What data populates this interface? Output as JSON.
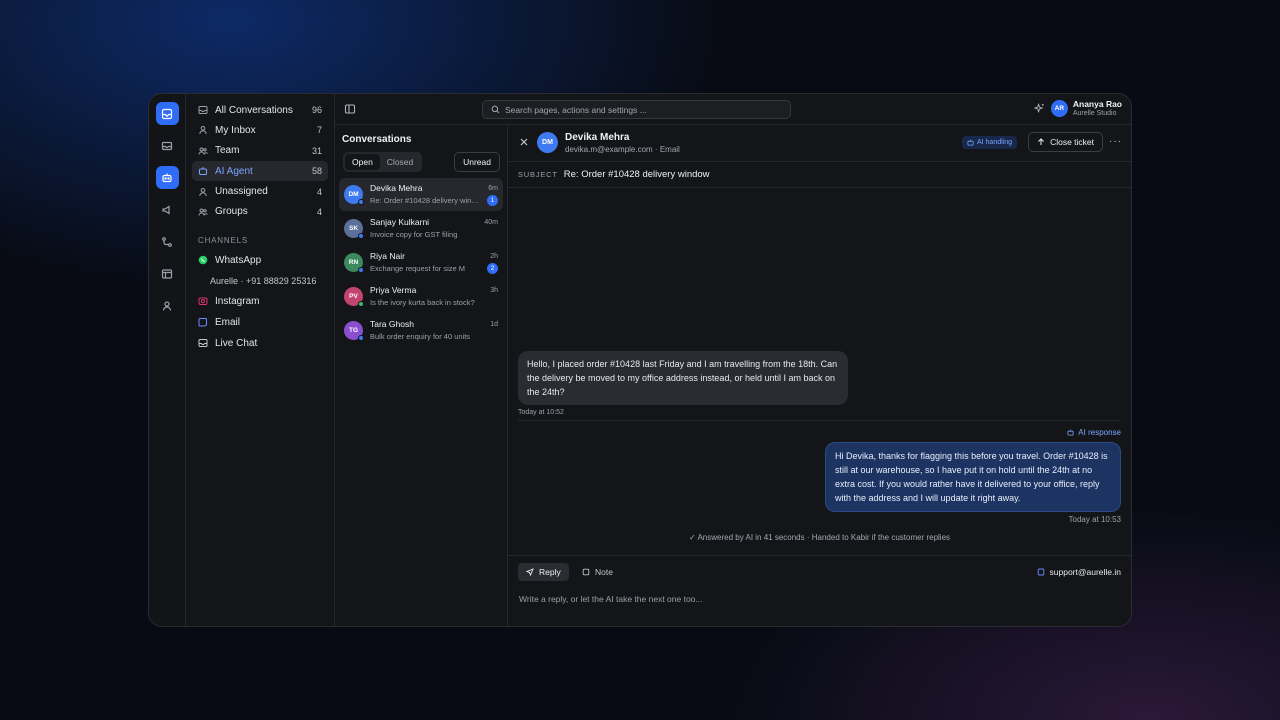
{
  "nav": {
    "items": [
      {
        "label": "All Conversations",
        "count": "96"
      },
      {
        "label": "My Inbox",
        "count": "7"
      },
      {
        "label": "Team",
        "count": "31"
      },
      {
        "label": "AI Agent",
        "count": "58"
      },
      {
        "label": "Unassigned",
        "count": "4"
      },
      {
        "label": "Groups",
        "count": "4"
      }
    ],
    "channels_title": "CHANNELS",
    "channels": [
      {
        "label": "WhatsApp",
        "sub": "Aurelle · +91 88829 25316"
      },
      {
        "label": "Instagram"
      },
      {
        "label": "Email"
      },
      {
        "label": "Live Chat"
      }
    ]
  },
  "search": {
    "placeholder": "Search pages, actions and settings ..."
  },
  "user": {
    "initials": "AR",
    "name": "Ananya Rao",
    "org": "Aurelle Studio"
  },
  "conversations": {
    "title": "Conversations",
    "tab_open": "Open",
    "tab_closed": "Closed",
    "unread": "Unread",
    "items": [
      {
        "initials": "DM",
        "name": "Devika Mehra",
        "time": "6m",
        "preview": "Re: Order #10428 delivery window",
        "badge": "1",
        "color": "#3f7bf0",
        "dot": "#3f7bf0"
      },
      {
        "initials": "SK",
        "name": "Sanjay Kulkarni",
        "time": "40m",
        "preview": "Invoice copy for GST filing",
        "badge": "",
        "color": "#5b6f9a",
        "dot": "#3f7bf0"
      },
      {
        "initials": "RN",
        "name": "Riya Nair",
        "time": "2h",
        "preview": "Exchange request for size M",
        "badge": "2",
        "color": "#3a8a5e",
        "dot": "#3f7bf0"
      },
      {
        "initials": "PV",
        "name": "Priya Verma",
        "time": "3h",
        "preview": "Is the ivory kurta back in stock?",
        "badge": "",
        "color": "#c2456f",
        "dot": "#2fbf6a"
      },
      {
        "initials": "TG",
        "name": "Tara Ghosh",
        "time": "1d",
        "preview": "Bulk order enquiry for 40 units",
        "badge": "",
        "color": "#8a4fd0",
        "dot": "#3f7bf0"
      }
    ]
  },
  "thread": {
    "initials": "DM",
    "name": "Devika Mehra",
    "sub": "devika.m@example.com · Email",
    "ai_chip": "AI handling",
    "close_ticket": "Close ticket",
    "more": "···",
    "subject_label": "SUBJECT",
    "subject": "Re: Order #10428 delivery window",
    "incoming": "Hello, I placed order #10428 last Friday and I am travelling from the 18th. Can the delivery be moved to my office address instead, or held until I am back on the 24th?",
    "incoming_time": "Today at 10:52",
    "ai_label": "AI response",
    "outgoing": "Hi Devika, thanks for flagging this before you travel. Order #10428 is still at our warehouse, so I have put it on hold until the 24th at no extra cost. If you would rather have it delivered to your office, reply with the address and I will update it right away.",
    "outgoing_time": "Today at 10:53",
    "note": "Answered by AI in 41 seconds · Handed to Kabir if the customer replies"
  },
  "composer": {
    "reply": "Reply",
    "note": "Note",
    "from": "support@aurelle.in",
    "placeholder": "Write a reply, or let the AI take the next one too..."
  },
  "colors": {
    "accent": "#2f6df6",
    "link": "#7aa5ff"
  }
}
